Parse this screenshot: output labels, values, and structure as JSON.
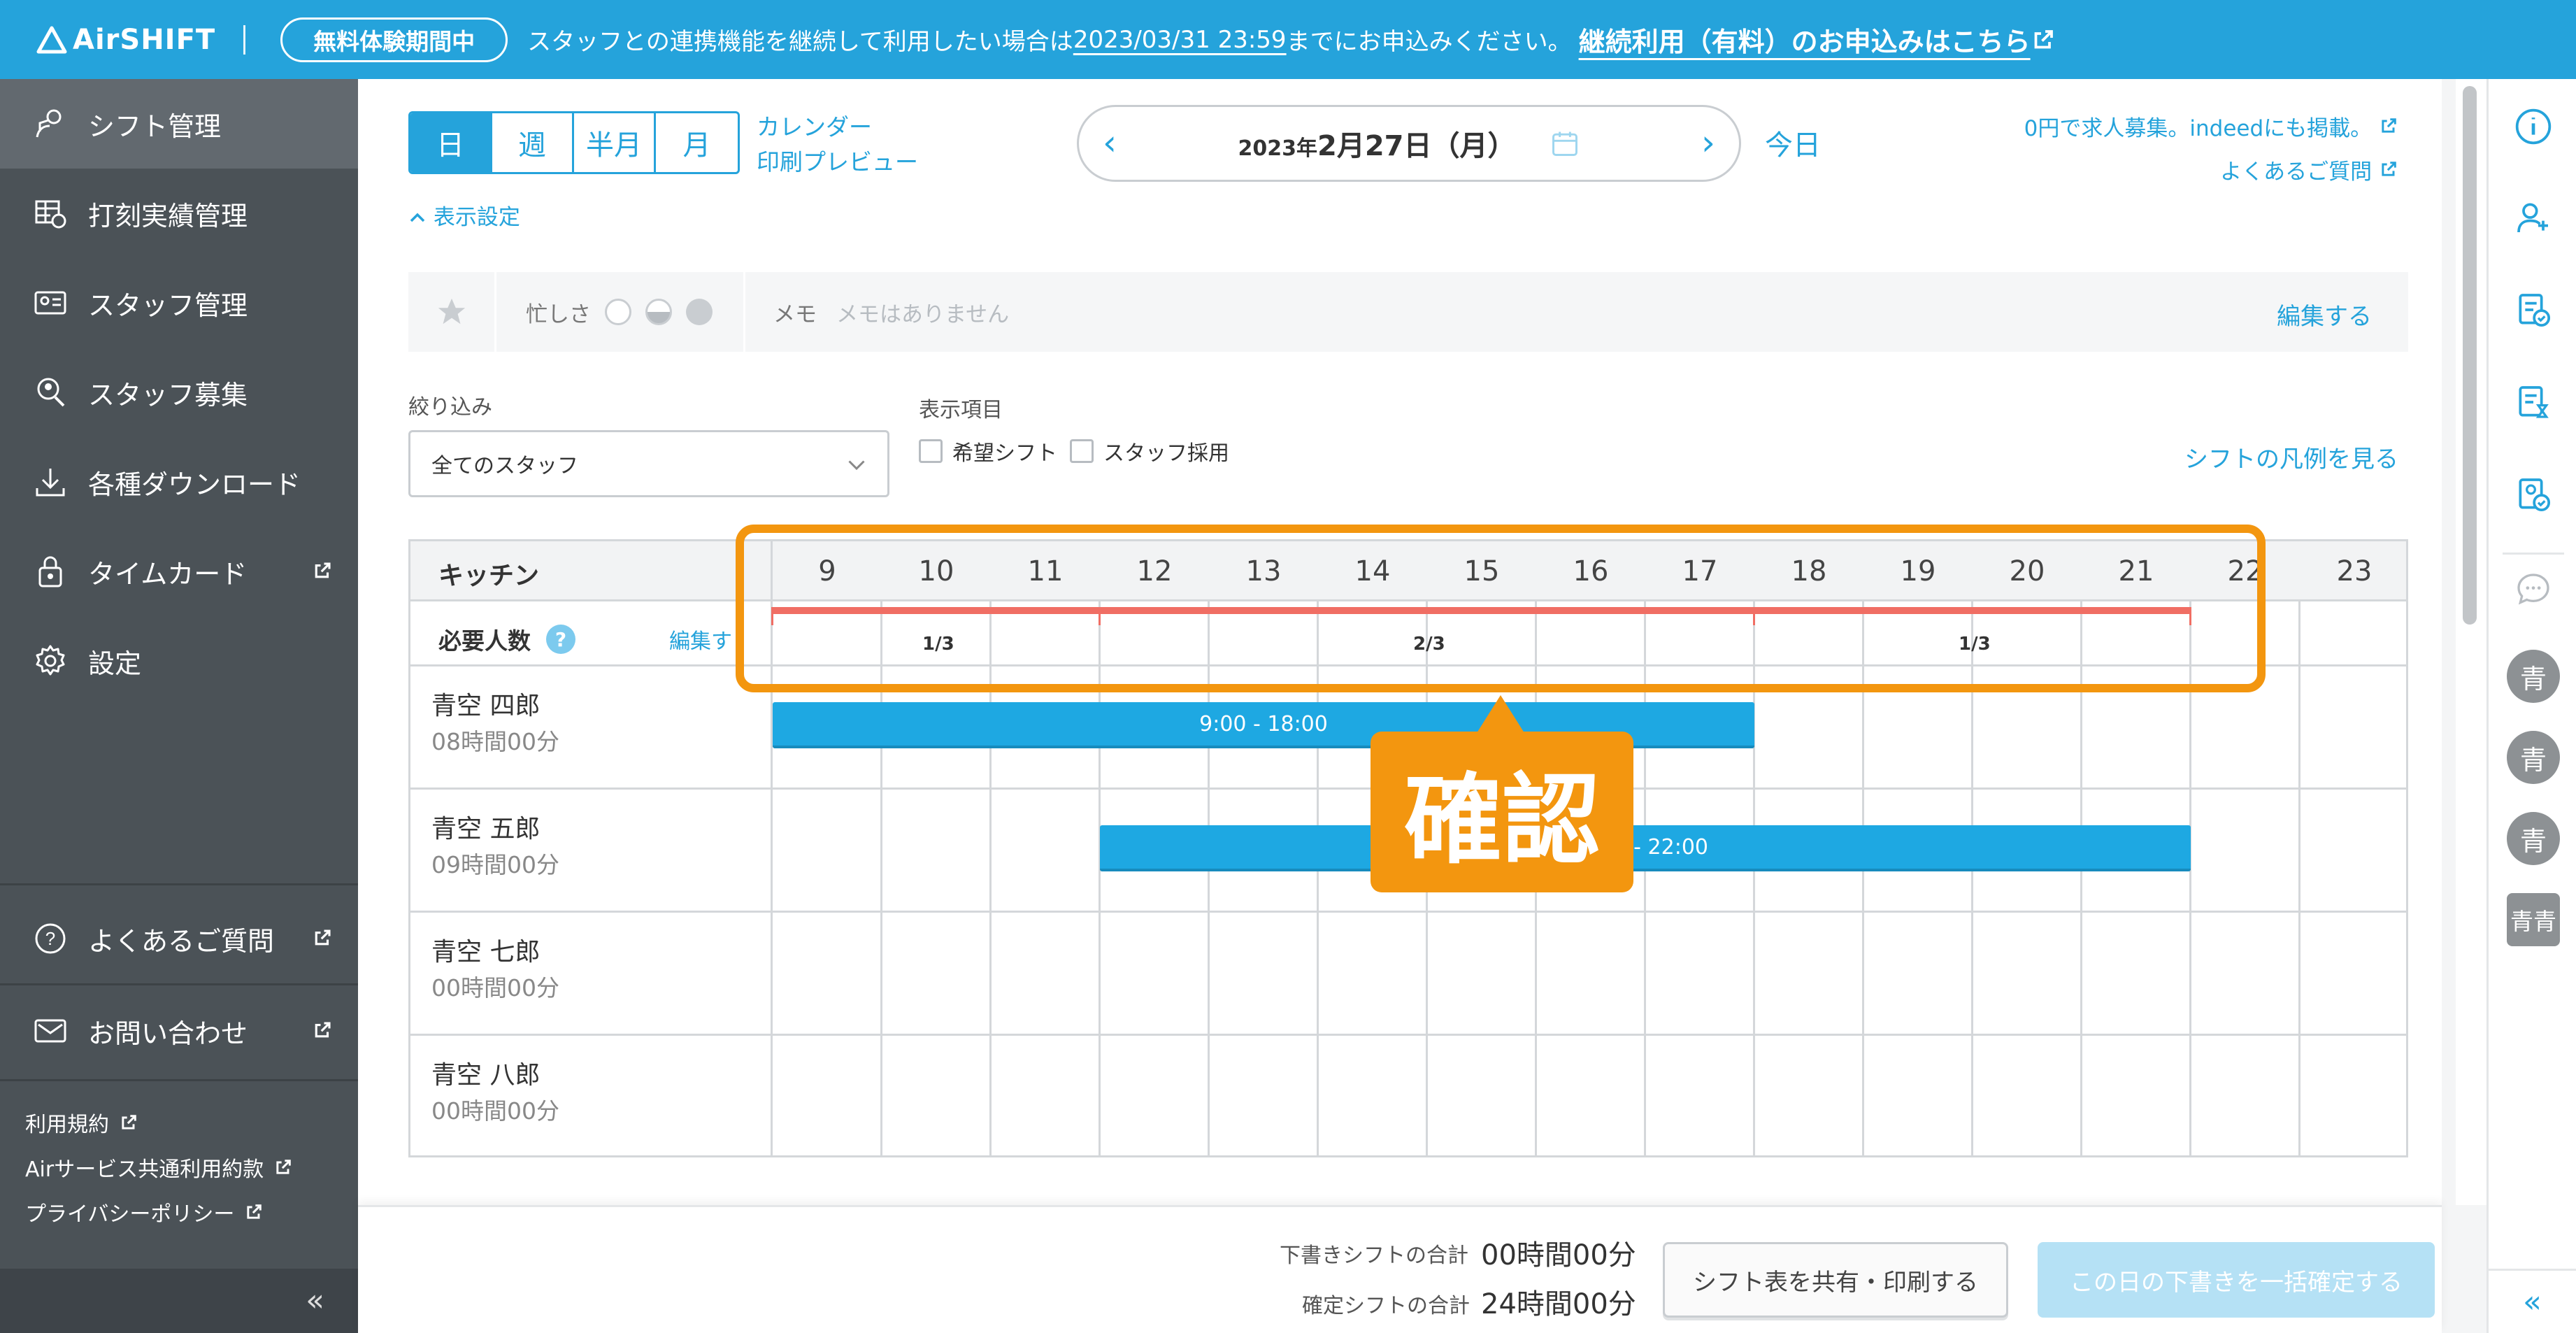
{
  "banner": {
    "logo": "AirSHIFT",
    "trial_badge": "無料体験期間中",
    "message_before": "スタッフとの連携機能を継続して利用したい場合は",
    "deadline": "2023/03/31 23:59",
    "message_after": "までにお申込みください。",
    "cta": "継続利用（有料）のお申込みはこちら"
  },
  "sidebar": {
    "items": [
      {
        "label": "シフト管理"
      },
      {
        "label": "打刻実績管理"
      },
      {
        "label": "スタッフ管理"
      },
      {
        "label": "スタッフ募集"
      },
      {
        "label": "各種ダウンロード"
      },
      {
        "label": "タイムカード"
      },
      {
        "label": "設定"
      }
    ],
    "faq": "よくあるご質問",
    "contact": "お問い合わせ",
    "legal": [
      "利用規約",
      "Airサービス共通利用約款",
      "プライバシーポリシー"
    ],
    "collapse": "«"
  },
  "toolbar": {
    "views": [
      "日",
      "週",
      "半月",
      "月"
    ],
    "calendar_preview_1": "カレンダー",
    "calendar_preview_2": "印刷プレビュー",
    "date_year": "2023年",
    "date_main": "2月27日（月）",
    "today": "今日",
    "link_jobs": "0円で求人募集。indeedにも掲載。",
    "link_faq": "よくあるご質問",
    "display_settings": "表示設定"
  },
  "busy": {
    "label": "忙しさ",
    "memo_label": "メモ",
    "memo_placeholder": "メモはありません",
    "edit": "編集する"
  },
  "filter": {
    "label": "絞り込み",
    "value": "全てのスタッフ",
    "items_label": "表示項目",
    "cb_wish": "希望シフト",
    "cb_hire": "スタッフ採用",
    "legend_link": "シフトの凡例を見る"
  },
  "table": {
    "section": "キッチン",
    "hours": [
      "9",
      "10",
      "11",
      "12",
      "13",
      "14",
      "15",
      "16",
      "17",
      "18",
      "19",
      "20",
      "21",
      "22",
      "23"
    ],
    "required_label": "必要人数",
    "required_help": "?",
    "required_edit": "編集す",
    "required_values": [
      {
        "value": "1/3",
        "start": 9,
        "end": 12
      },
      {
        "value": "2/3",
        "start": 12,
        "end": 18
      },
      {
        "value": "1/3",
        "start": 18,
        "end": 22
      }
    ],
    "staff": [
      {
        "name": "青空 四郎",
        "hours": "08時間00分",
        "shift": "9:00 - 18:00",
        "start": 9,
        "end": 18
      },
      {
        "name": "青空 五郎",
        "hours": "09時間00分",
        "shift": "- 22:00",
        "start": 12,
        "end": 22
      },
      {
        "name": "青空 七郎",
        "hours": "00時間00分"
      },
      {
        "name": "青空 八郎",
        "hours": "00時間00分"
      }
    ]
  },
  "callout": {
    "text": "確認"
  },
  "footer": {
    "draft_label": "下書きシフトの合計",
    "draft_value": "00時間00分",
    "confirmed_label": "確定シフトの合計",
    "confirmed_value": "24時間00分",
    "share_button": "シフト表を共有・印刷する",
    "confirm_button": "この日の下書きを一括確定する"
  },
  "rail": {
    "avatars": [
      "青",
      "青",
      "青",
      "青青"
    ],
    "collapse": "«"
  },
  "colors": {
    "brand": "#25a3db",
    "shift": "#1ea8e2",
    "required": "#f06e64",
    "callout": "#f3960f",
    "sidebar": "#4b5257"
  }
}
